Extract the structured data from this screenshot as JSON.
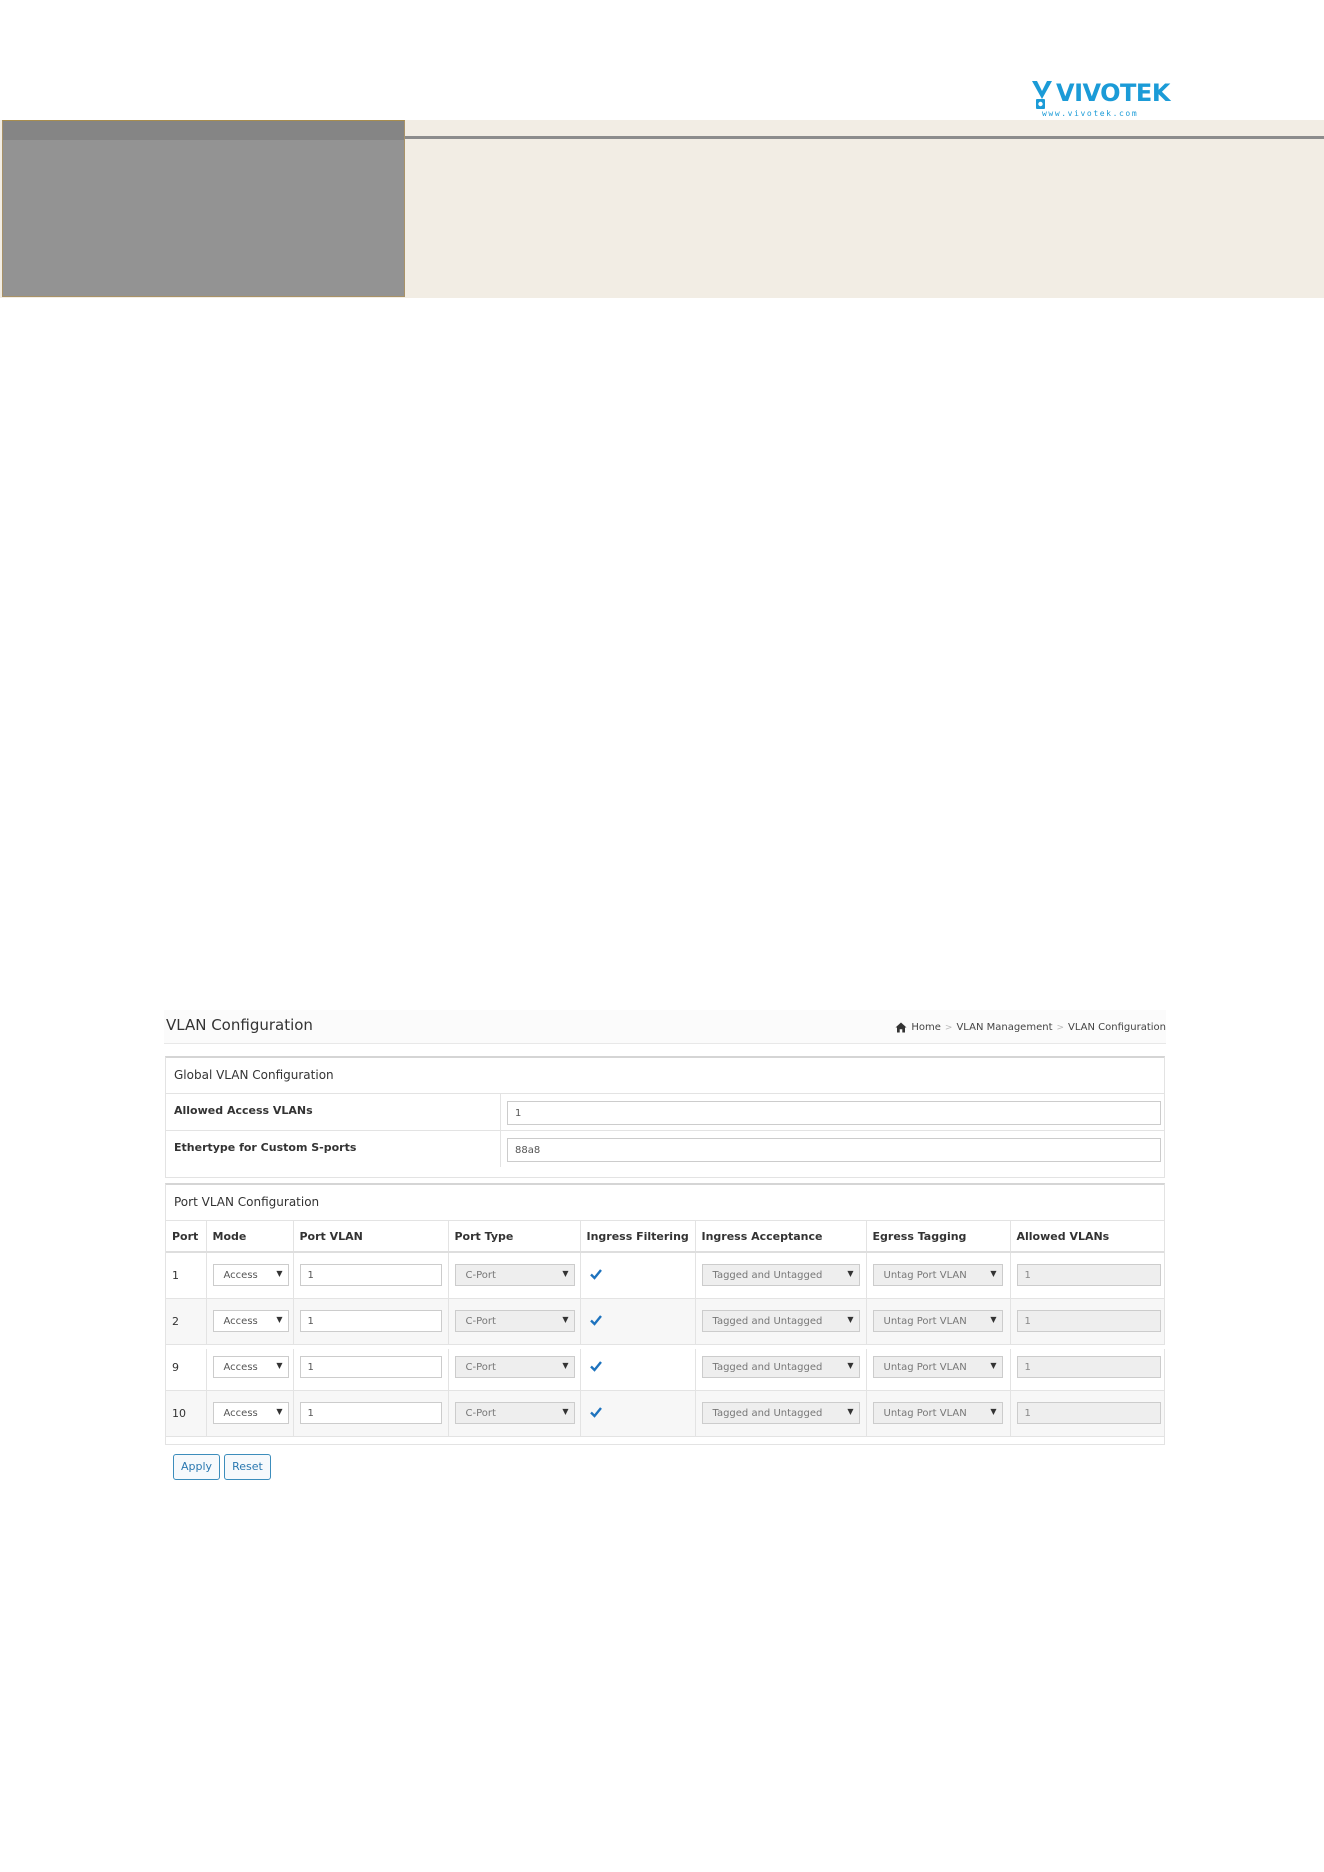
{
  "brand": {
    "logo_text": "VIVOTEK",
    "logo_url": "www.vivotek.com",
    "color": "#1b9bd7"
  },
  "header": {
    "title": "VLAN Configuration",
    "breadcrumb": {
      "icon": "home-icon",
      "items": [
        "Home",
        "VLAN Management",
        "VLAN Configuration"
      ]
    }
  },
  "global": {
    "title": "Global VLAN Configuration",
    "allowed_access_vlans": {
      "label": "Allowed Access VLANs",
      "value": "1"
    },
    "ethertype": {
      "label": "Ethertype for Custom S-ports",
      "value": "88a8"
    }
  },
  "port_config": {
    "title": "Port VLAN Configuration",
    "columns": [
      "Port",
      "Mode",
      "Port VLAN",
      "Port Type",
      "Ingress Filtering",
      "Ingress Acceptance",
      "Egress Tagging",
      "Allowed VLANs"
    ],
    "rows": [
      {
        "port": "1",
        "mode": "Access",
        "port_vlan": "1",
        "port_type": "C-Port",
        "ingress_filtering": true,
        "ingress_acceptance": "Tagged and Untagged",
        "egress_tagging": "Untag Port VLAN",
        "allowed_vlans": "1"
      },
      {
        "port": "2",
        "mode": "Access",
        "port_vlan": "1",
        "port_type": "C-Port",
        "ingress_filtering": true,
        "ingress_acceptance": "Tagged and Untagged",
        "egress_tagging": "Untag Port VLAN",
        "allowed_vlans": "1"
      },
      {
        "port": "9",
        "mode": "Access",
        "port_vlan": "1",
        "port_type": "C-Port",
        "ingress_filtering": true,
        "ingress_acceptance": "Tagged and Untagged",
        "egress_tagging": "Untag Port VLAN",
        "allowed_vlans": "1"
      },
      {
        "port": "10",
        "mode": "Access",
        "port_vlan": "1",
        "port_type": "C-Port",
        "ingress_filtering": true,
        "ingress_acceptance": "Tagged and Untagged",
        "egress_tagging": "Untag Port VLAN",
        "allowed_vlans": "1"
      }
    ]
  },
  "buttons": {
    "apply": "Apply",
    "reset": "Reset"
  },
  "colors": {
    "accent": "#3c8dbc",
    "checkbox": "#1e73be"
  }
}
